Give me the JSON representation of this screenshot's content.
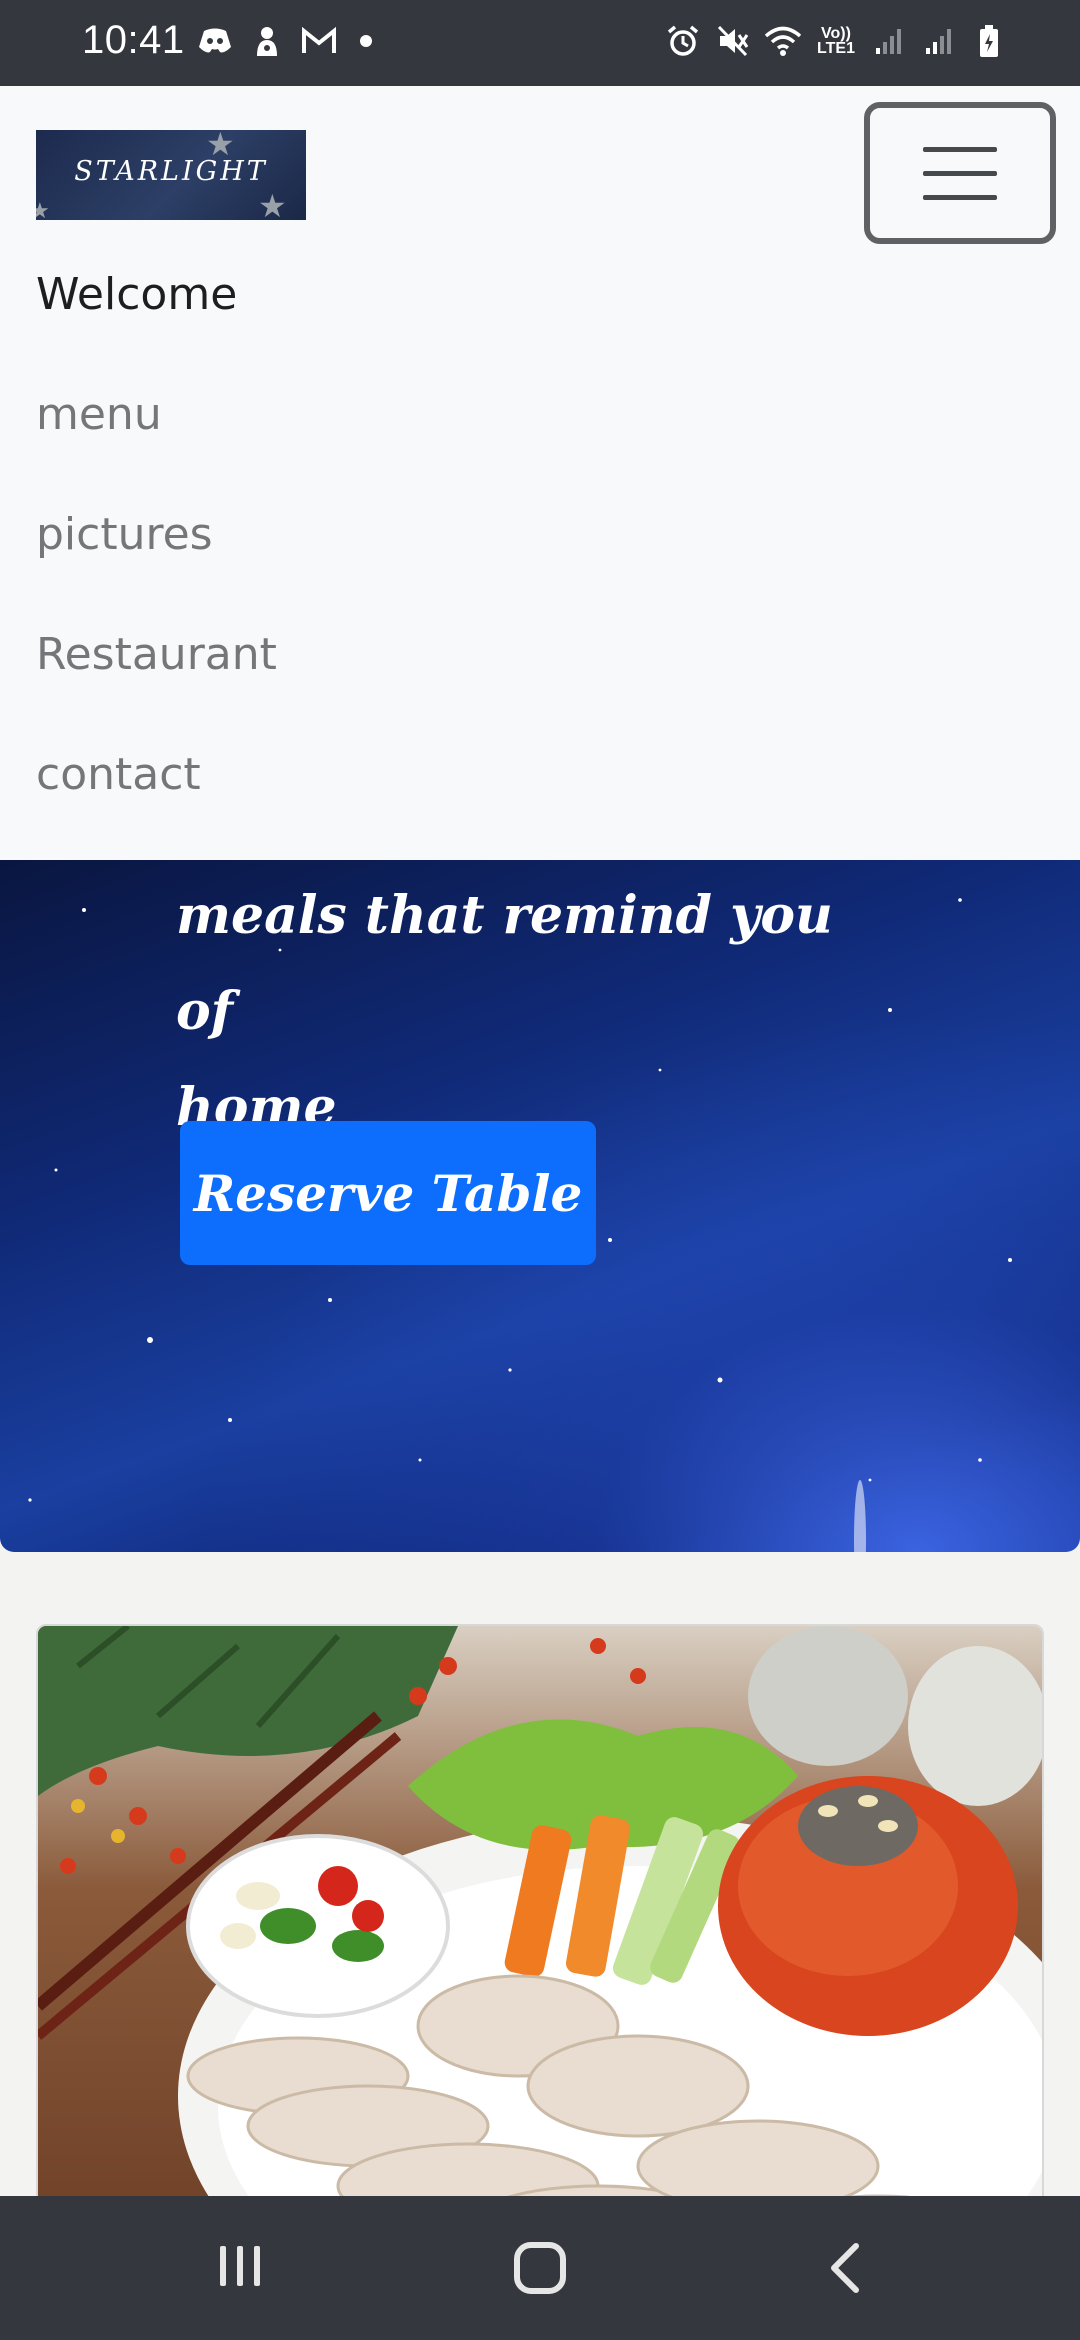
{
  "status_bar": {
    "time": "10:41",
    "left_icons": [
      "discord-icon",
      "notification-app-icon",
      "gmail-icon",
      "dot-icon"
    ],
    "right_icons": [
      "alarm-icon",
      "mute-icon",
      "wifi-icon",
      "volte-icon",
      "signal-icon",
      "signal-icon-2",
      "battery-icon"
    ],
    "volte_label_top": "Vo))",
    "volte_label_bottom": "LTE1"
  },
  "navbar": {
    "logo_text": "STARLIGHT",
    "links": [
      {
        "label": "Welcome",
        "active": true
      },
      {
        "label": "menu",
        "active": false
      },
      {
        "label": "pictures",
        "active": false
      },
      {
        "label": "Restaurant",
        "active": false
      },
      {
        "label": "contact",
        "active": false
      }
    ]
  },
  "hero": {
    "line1": "meals that remind you of",
    "line2": "home",
    "button_label": "Reserve Table",
    "button_color": "#0d6efd"
  },
  "card": {
    "image_description_icon": "food-platter-image"
  },
  "bottom_nav": {
    "items": [
      "recent-apps-icon",
      "home-icon",
      "back-icon"
    ]
  }
}
